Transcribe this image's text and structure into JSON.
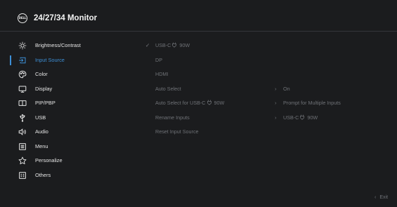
{
  "header": {
    "logo_text": "DELL",
    "title": "24/27/34 Monitor"
  },
  "menu": {
    "active_index": 1,
    "items": [
      {
        "label": "Brightness/Contrast",
        "icon": "brightness-icon"
      },
      {
        "label": "Input Source",
        "icon": "input-source-icon"
      },
      {
        "label": "Color",
        "icon": "color-palette-icon"
      },
      {
        "label": "Display",
        "icon": "display-icon"
      },
      {
        "label": "PIP/PBP",
        "icon": "pip-pbp-icon"
      },
      {
        "label": "USB",
        "icon": "usb-icon"
      },
      {
        "label": "Audio",
        "icon": "audio-icon"
      },
      {
        "label": "Menu",
        "icon": "menu-icon"
      },
      {
        "label": "Personalize",
        "icon": "star-icon"
      },
      {
        "label": "Others",
        "icon": "others-icon"
      }
    ]
  },
  "submenu": {
    "items": [
      {
        "label_prefix": "USB-C",
        "label_suffix": "90W",
        "selected": true
      },
      {
        "label": "DP"
      },
      {
        "label": "HDMI"
      },
      {
        "label": "Auto Select",
        "value": "On"
      },
      {
        "label_prefix": "Auto Select for USB-C",
        "label_suffix": "90W",
        "value": "Prompt for Multiple Inputs"
      },
      {
        "label": "Rename Inputs",
        "value_prefix": "USB-C",
        "value_suffix": "90W"
      },
      {
        "label": "Reset Input Source"
      }
    ],
    "check_glyph": "✓",
    "chevron_glyph": "›"
  },
  "footer": {
    "exit_arrow": "‹",
    "exit_label": "Exit"
  },
  "colors": {
    "background": "#1b1c1e",
    "accent": "#3d8fd6",
    "text": "#e6e6e6",
    "dim_text": "#6f7277"
  }
}
